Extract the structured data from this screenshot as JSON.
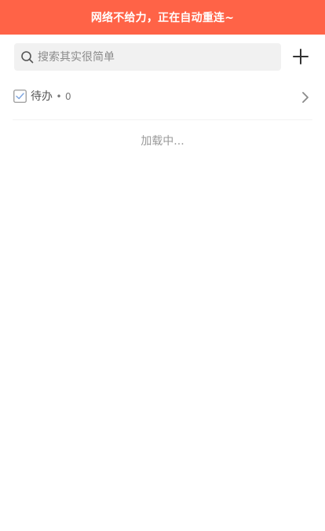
{
  "banner": {
    "text": "网络不给力，正在自动重连~",
    "color": "#ff6347"
  },
  "search": {
    "placeholder": "搜索其实很简单",
    "value": "",
    "icon": "search-icon"
  },
  "toolbar": {
    "add_icon": "plus-icon"
  },
  "todo": {
    "icon": "checkbox-icon",
    "label": "待办",
    "separator": "•",
    "count": "0",
    "chevron_icon": "chevron-right-icon"
  },
  "status": {
    "loading_text": "加载中..."
  }
}
